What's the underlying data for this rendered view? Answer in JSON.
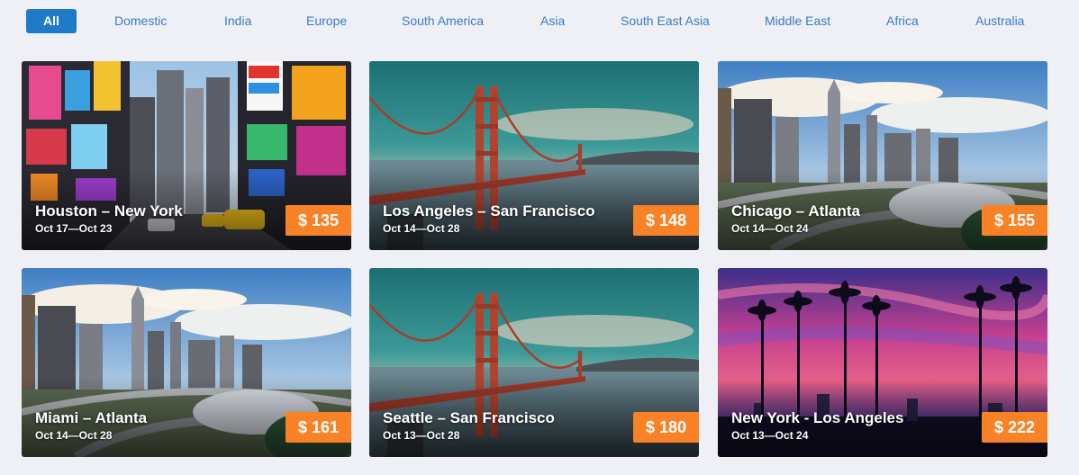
{
  "tabs": [
    {
      "label": "All",
      "active": true
    },
    {
      "label": "Domestic",
      "active": false
    },
    {
      "label": "India",
      "active": false
    },
    {
      "label": "Europe",
      "active": false
    },
    {
      "label": "South America",
      "active": false
    },
    {
      "label": "Asia",
      "active": false
    },
    {
      "label": "South East Asia",
      "active": false
    },
    {
      "label": "Middle East",
      "active": false
    },
    {
      "label": "Africa",
      "active": false
    },
    {
      "label": "Australia",
      "active": false
    }
  ],
  "deals": [
    {
      "route": "Houston – New York",
      "dates": "Oct 17—Oct 23",
      "price": "$ 135",
      "scene": "times-square"
    },
    {
      "route": "Los Angeles – San Francisco",
      "dates": "Oct 14—Oct 28",
      "price": "$ 148",
      "scene": "golden-gate-bridge"
    },
    {
      "route": "Chicago – Atlanta",
      "dates": "Oct 14—Oct 24",
      "price": "$ 155",
      "scene": "city-skyline"
    },
    {
      "route": "Miami – Atlanta",
      "dates": "Oct 14—Oct 28",
      "price": "$ 161",
      "scene": "city-skyline"
    },
    {
      "route": "Seattle – San Francisco",
      "dates": "Oct 13—Oct 28",
      "price": "$ 180",
      "scene": "golden-gate-bridge"
    },
    {
      "route": "New York - Los Angeles",
      "dates": "Oct 13—Oct 24",
      "price": "$ 222",
      "scene": "palm-sunset"
    }
  ],
  "colors": {
    "active_tab": "#1f7ac8",
    "tab_text": "#3a7bbf",
    "price_badge": "#fa8226",
    "page_background": "#eef0f5"
  }
}
